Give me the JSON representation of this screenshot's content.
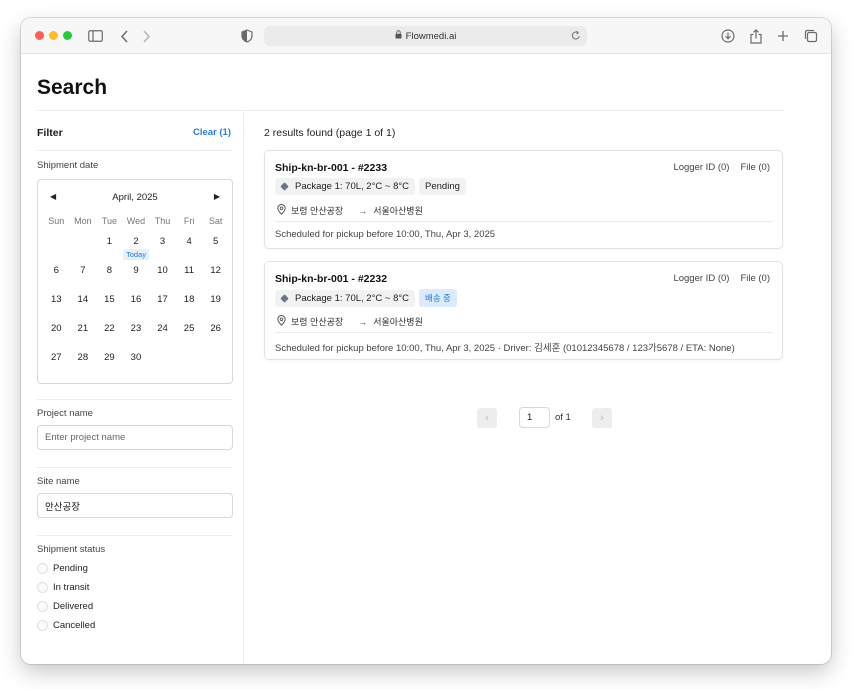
{
  "browser": {
    "url": "Flowmedi.ai"
  },
  "page": {
    "title": "Search"
  },
  "filter": {
    "label": "Filter",
    "clear": "Clear (1)",
    "shipment_date": {
      "label": "Shipment date",
      "month": "April, 2025",
      "weekdays": [
        "Sun",
        "Mon",
        "Tue",
        "Wed",
        "Thu",
        "Fri",
        "Sat"
      ],
      "weeks": [
        [
          "",
          "",
          "1",
          "2",
          "3",
          "4",
          "5"
        ],
        [
          "6",
          "7",
          "8",
          "9",
          "10",
          "11",
          "12"
        ],
        [
          "13",
          "14",
          "15",
          "16",
          "17",
          "18",
          "19"
        ],
        [
          "20",
          "21",
          "22",
          "23",
          "24",
          "25",
          "26"
        ],
        [
          "27",
          "28",
          "29",
          "30",
          "",
          "",
          ""
        ]
      ],
      "today_day": "2",
      "today_label": "Today"
    },
    "project_name": {
      "label": "Project name",
      "placeholder": "Enter project name",
      "value": ""
    },
    "site_name": {
      "label": "Site name",
      "value": "안산공장"
    },
    "shipment_status": {
      "label": "Shipment status",
      "options": [
        "Pending",
        "In transit",
        "Delivered",
        "Cancelled"
      ]
    }
  },
  "results": {
    "summary": "2 results found (page 1 of 1)",
    "items": [
      {
        "title": "Ship-kn-br-001 - #2233",
        "logger": "Logger ID (0)",
        "file": "File (0)",
        "package": "Package 1: 70L, 2°C ~ 8°C",
        "status": "Pending",
        "status_style": "gray",
        "origin": "보령 안산공장",
        "destination": "서울아산병원",
        "footer": "Scheduled for pickup before 10:00, Thu, Apr 3, 2025"
      },
      {
        "title": "Ship-kn-br-001 - #2232",
        "logger": "Logger ID (0)",
        "file": "File (0)",
        "package": "Package 1: 70L, 2°C ~ 8°C",
        "status": "배송 중",
        "status_style": "blue",
        "origin": "보령 안산공장",
        "destination": "서울아산병원",
        "footer": "Scheduled for pickup before 10:00, Thu, Apr 3, 2025 · Driver: 김세훈 (01012345678 / 123가5678 / ETA: None)"
      }
    ]
  },
  "pagination": {
    "current": "1",
    "of": "of 1"
  },
  "colors": {
    "accent": "#2a7bd3",
    "badge_blue_bg": "#dcebfc"
  }
}
